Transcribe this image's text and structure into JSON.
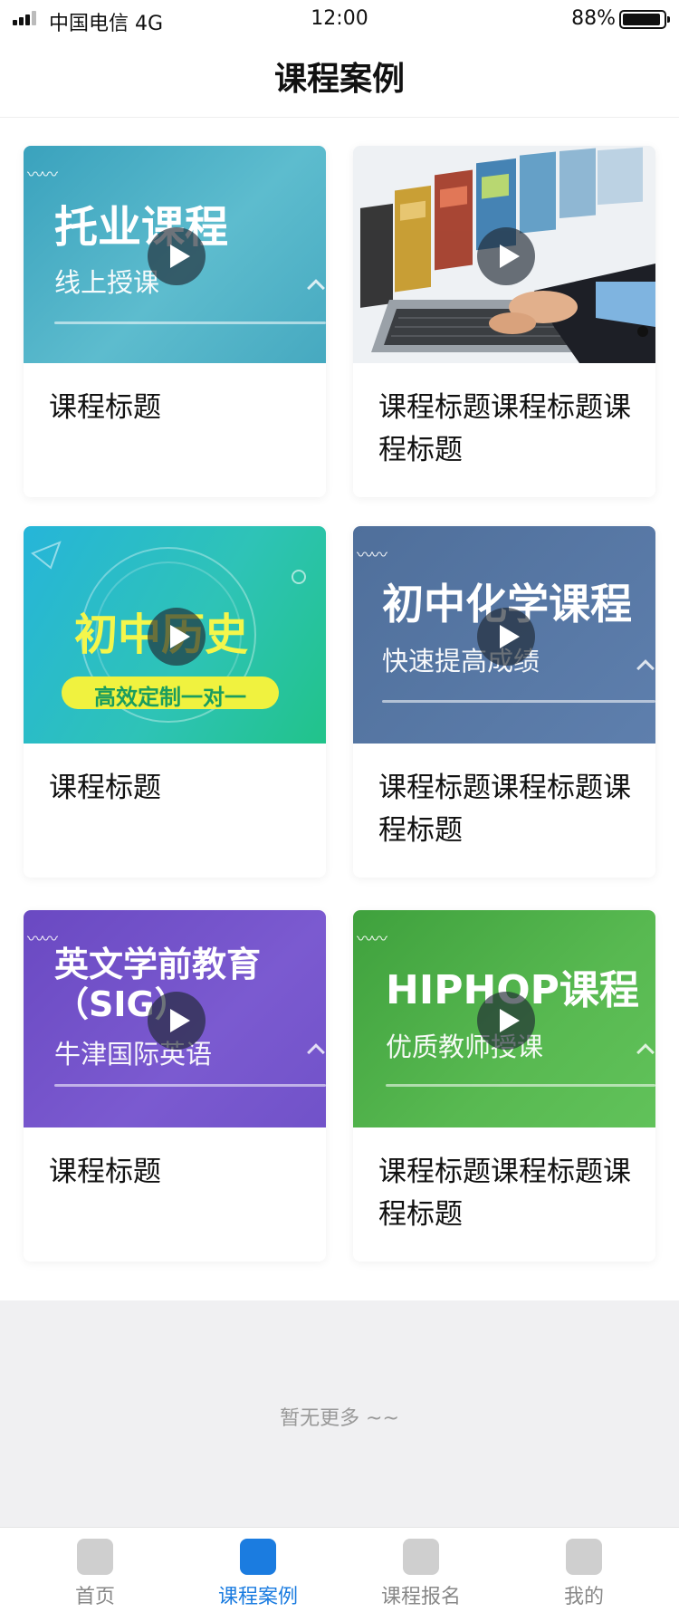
{
  "status_bar": {
    "carrier": "中国电信  4G",
    "time": "12:00",
    "battery": "88%"
  },
  "nav": {
    "title": "课程案例"
  },
  "courses": [
    {
      "thumb_title": "托业课程",
      "thumb_subtitle": "线上授课",
      "title": "课程标题"
    },
    {
      "thumb_title": "",
      "thumb_subtitle": "",
      "title": "课程标题课程标题课程标题"
    },
    {
      "thumb_title": "初中历史",
      "thumb_subtitle": "高效定制一对一",
      "title": "课程标题"
    },
    {
      "thumb_title": "初中化学课程",
      "thumb_subtitle": "快速提高成绩",
      "title": "课程标题课程标题课程标题"
    },
    {
      "thumb_title": "英文学前教育（SIG）",
      "thumb_subtitle": "牛津国际英语",
      "title": "课程标题"
    },
    {
      "thumb_title": "HIPHOP课程",
      "thumb_subtitle": "优质教师授课",
      "title": "课程标题课程标题课程标题"
    }
  ],
  "footer": {
    "no_more": "暂无更多 ~~"
  },
  "tab_bar": {
    "active_color": "#1b7ce0",
    "items": [
      {
        "label": "首页"
      },
      {
        "label": "课程案例",
        "active": true
      },
      {
        "label": "课程报名"
      },
      {
        "label": "我的"
      }
    ]
  }
}
